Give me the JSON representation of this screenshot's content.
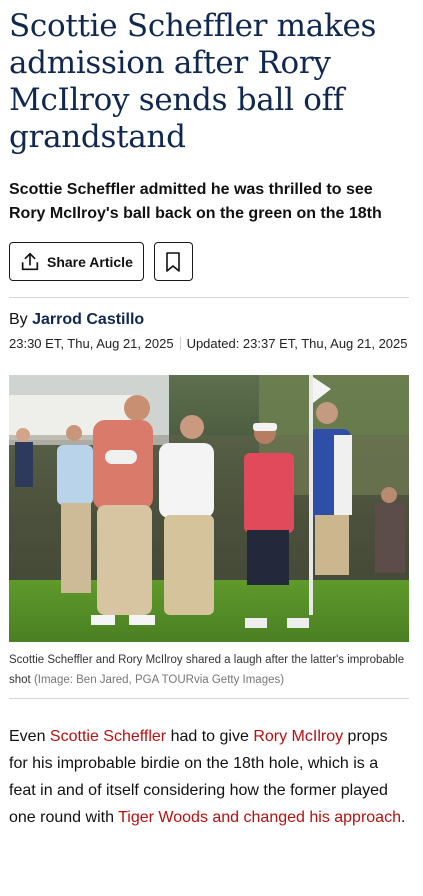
{
  "article": {
    "headline": "Scottie Scheffler makes admission after Rory McIlroy sends ball off grandstand",
    "subheadline": "Scottie Scheffler admitted he was thrilled to see Rory McIlroy's ball back on the green on the 18th",
    "share_label": "Share Article",
    "byline_prefix": "By",
    "author": "Jarrod Castillo",
    "published": "23:30 ET, Thu, Aug 21, 2025",
    "updated": "Updated: 23:37 ET, Thu, Aug 21, 2025",
    "caption": "Scottie Scheffler and Rory McIlroy shared a laugh after the latter's improbable shot",
    "credit": "(Image: Ben Jared, PGA TOURvia Getty Images)"
  },
  "body": {
    "p1_text1": "Even ",
    "p1_link1": "Scottie Scheffler",
    "p1_text2": " had to give ",
    "p1_link2": "Rory McIlroy",
    "p1_text3": " props for his improbable birdie on the 18th hole, which is a feat in and of itself considering how the former played one round with ",
    "p1_link3": "Tiger Woods and changed his approach",
    "p1_text4": "."
  },
  "icons": {
    "share": "share-upload-icon",
    "bookmark": "bookmark-icon"
  },
  "colors": {
    "headline": "#10284f",
    "link": "#b31212",
    "author": "#10284f"
  }
}
